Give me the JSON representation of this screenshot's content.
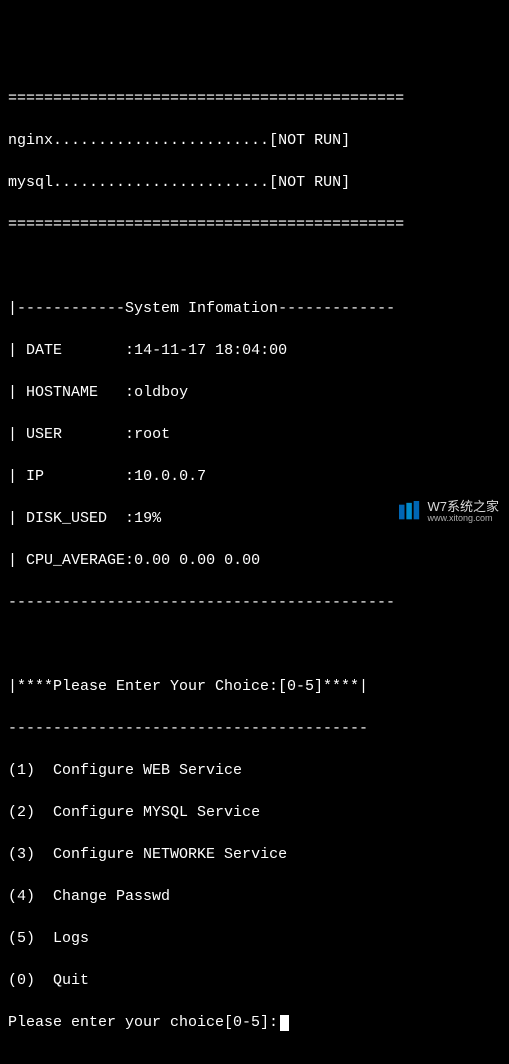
{
  "divider_top": "============================================",
  "services": [
    {
      "name": "nginx",
      "dots": "........................",
      "status": "[NOT RUN]"
    },
    {
      "name": "mysql",
      "dots": "........................",
      "status": "[NOT RUN]"
    }
  ],
  "divider_mid": "============================================",
  "sysinfo": {
    "header_open": "|------------",
    "header_title": "System Infomation",
    "header_close": "-------------",
    "rows": [
      {
        "label": "DATE",
        "pad": "       ",
        "value": "14-11-17 18:04:00"
      },
      {
        "label": "HOSTNAME",
        "pad": "   ",
        "value": "oldboy"
      },
      {
        "label": "USER",
        "pad": "       ",
        "value": "root"
      },
      {
        "label": "IP",
        "pad": "         ",
        "value": "10.0.0.7"
      },
      {
        "label": "DISK_USED",
        "pad": "  ",
        "value": "19%"
      },
      {
        "label": "CPU_AVERAGE",
        "pad": "",
        "value": "0.00 0.00 0.00"
      }
    ],
    "footer": "-------------------------------------------"
  },
  "choice_prompt": "|****Please Enter Your Choice:[0-5]****|",
  "choice_divider": "----------------------------------------",
  "menu": [
    {
      "num": "(1)",
      "label": "Configure WEB Service"
    },
    {
      "num": "(2)",
      "label": "Configure MYSQL Service"
    },
    {
      "num": "(3)",
      "label": "Configure NETWORKE Service"
    },
    {
      "num": "(4)",
      "label": "Change Passwd"
    },
    {
      "num": "(5)",
      "label": "Logs"
    },
    {
      "num": "(0)",
      "label": "Quit"
    }
  ],
  "input_prompt": "Please enter your choice[0-5]:",
  "watermark": {
    "title": "W7系统之家",
    "url": "www.xitong.com"
  }
}
